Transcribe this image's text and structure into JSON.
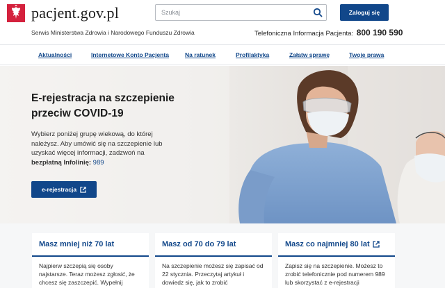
{
  "header": {
    "logo_text": "pacjent.gov.pl",
    "tagline": "Serwis Ministerstwa Zdrowia i Narodowego Funduszu Zdrowia",
    "search_placeholder": "Szukaj",
    "login_label": "Zaloguj się",
    "hotline_label": "Telefoniczna Informacja Pacjenta:",
    "hotline_number": "800 190 590"
  },
  "nav": {
    "items": [
      "Aktualności",
      "Internetowe Konto Pacjenta",
      "Na ratunek",
      "Profilaktyka",
      "Załatw sprawę",
      "Twoje prawa"
    ]
  },
  "hero": {
    "title": "E-rejestracja na szczepienie przeciw COVID-19",
    "desc_text": "Wybierz poniżej grupę wiekową, do której należysz. Aby umówić się na szczepienie lub uzyskać więcej informacji, zadzwoń na",
    "desc_bold": "bezpłatną Infolinię:",
    "desc_link": "989",
    "button_label": "e-rejestracja"
  },
  "cards": [
    {
      "title": "Masz mniej niż 70 lat",
      "text": "Najpierw szczepią się osoby najstarsze. Teraz możesz zgłosić, że chcesz się zaszczepić. Wypełnij"
    },
    {
      "title": "Masz od 70 do 79 lat",
      "text": "Na szczepienie możesz się zapisać od 22 stycznia. Przeczytaj artykuł i dowiedz się, jak to zrobić"
    },
    {
      "title": "Masz co najmniej 80 lat",
      "text": "Zapisz się na szczepienie. Możesz to zrobić telefonicznie pod numerem 989 lub skorzystać z e-rejestracji"
    }
  ],
  "colors": {
    "brand_blue": "#11478a",
    "logo_red": "#d4213d"
  },
  "icons": {
    "logo": "polish-eagle-icon",
    "search": "search-icon",
    "external": "external-link-icon"
  }
}
